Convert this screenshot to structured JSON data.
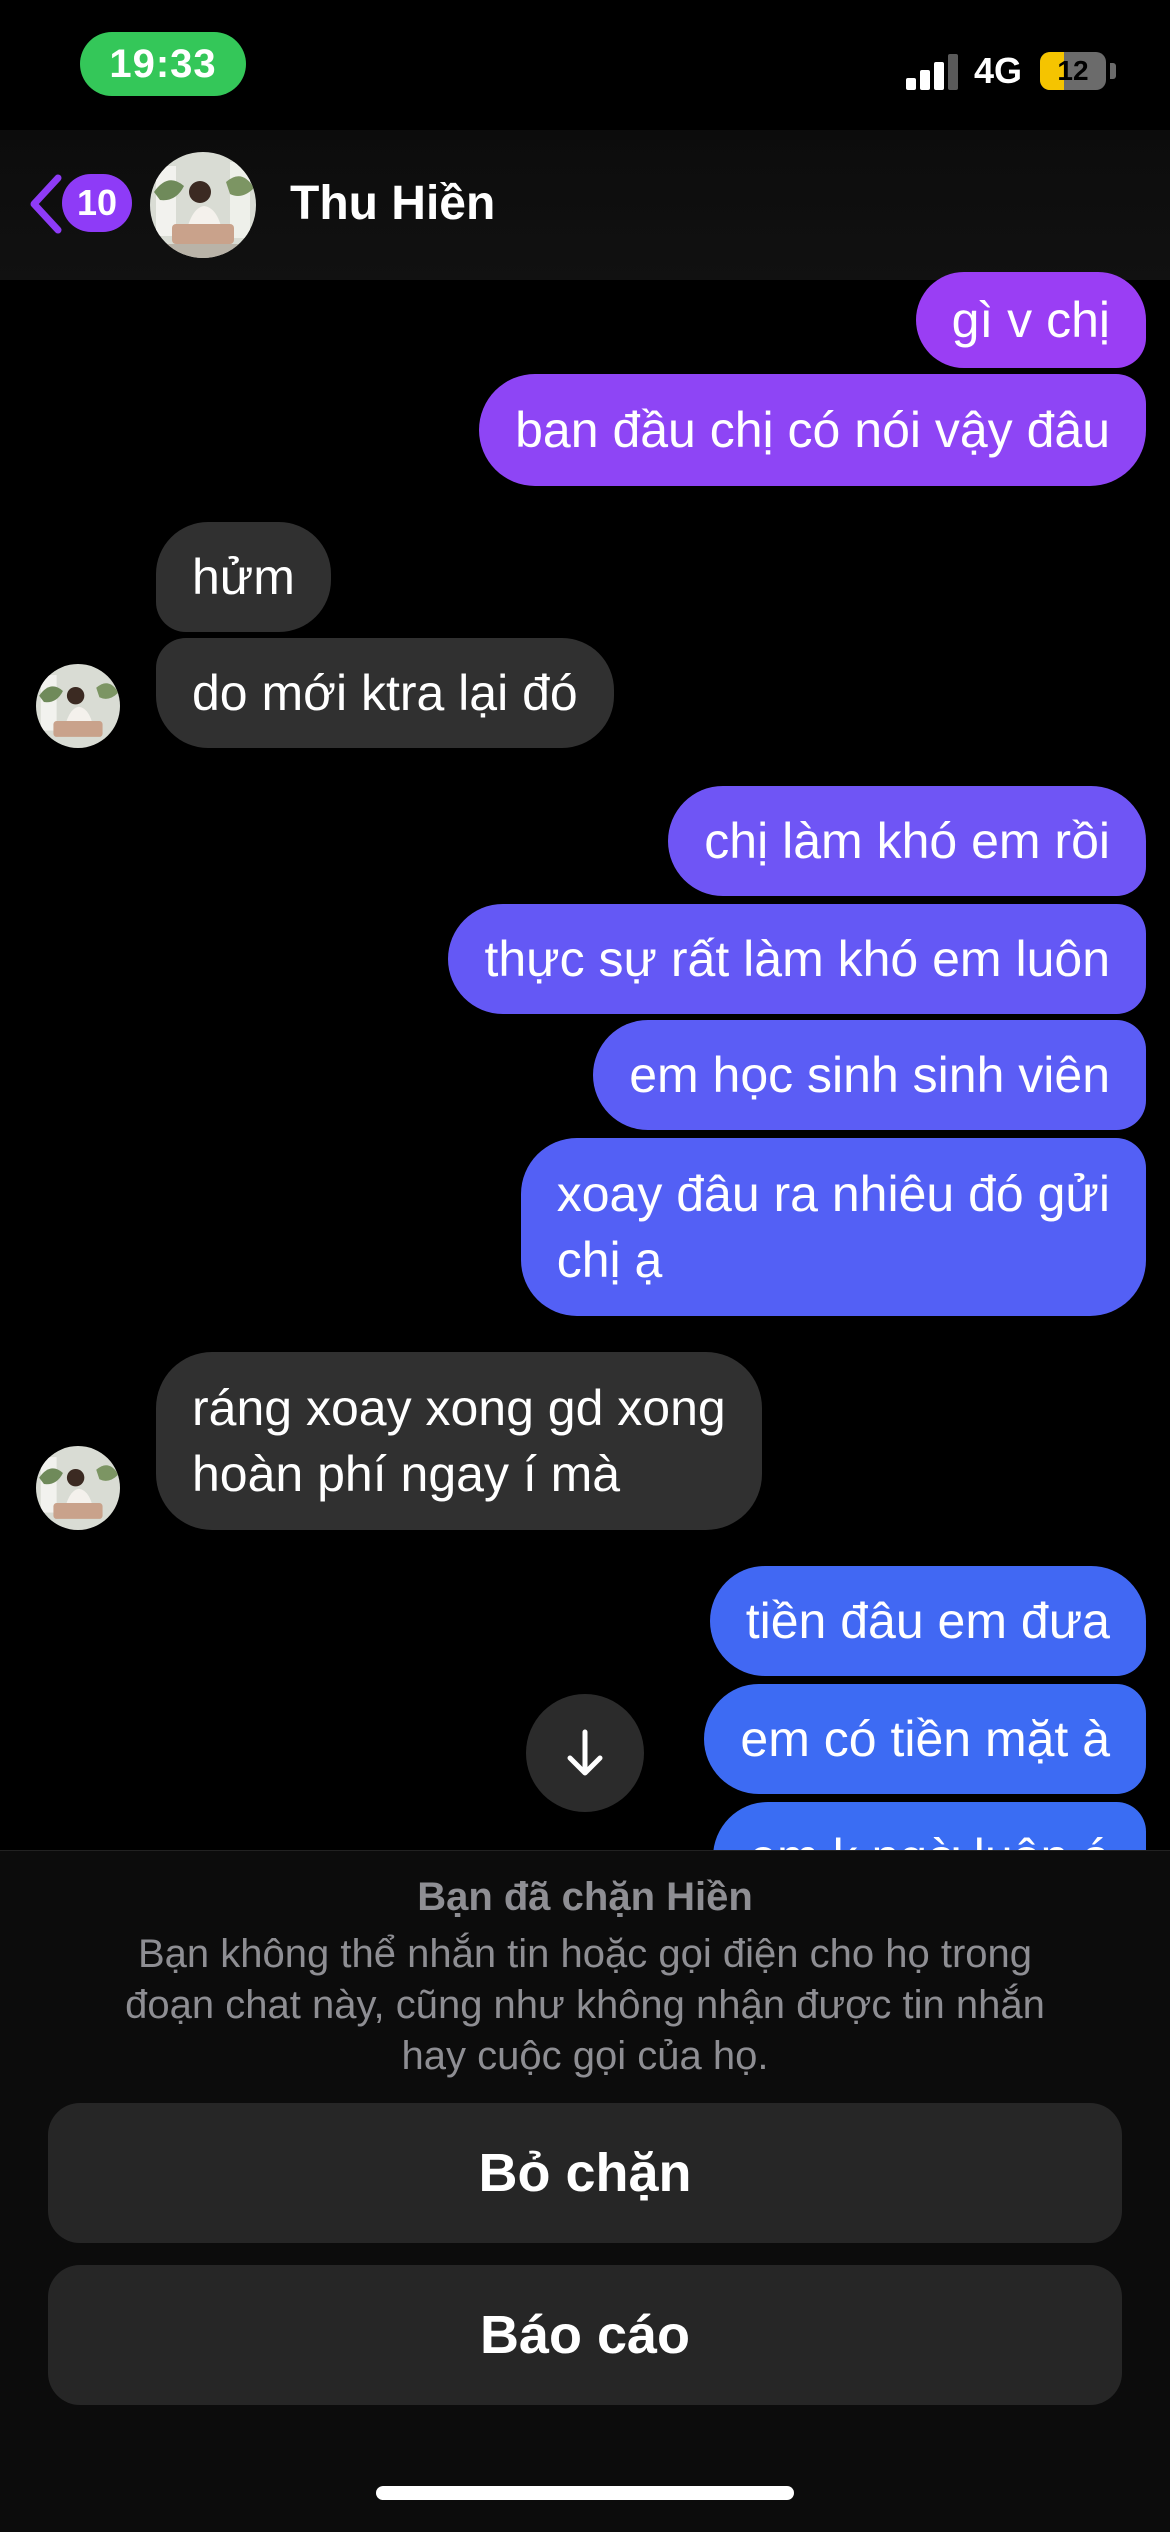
{
  "status_bar": {
    "time": "19:33",
    "network": "4G",
    "battery": "12",
    "battery_level": 0.12
  },
  "header": {
    "unread_count": "10",
    "contact_name": "Thu Hiền"
  },
  "messages": [
    {
      "side": "sent",
      "text": "gì v chị"
    },
    {
      "side": "sent",
      "text": "ban đầu chị có nói vậy đâu"
    },
    {
      "side": "received",
      "text": "hửm"
    },
    {
      "side": "received",
      "text": "do mới ktra lại đó"
    },
    {
      "side": "sent",
      "text": "chị làm khó em rồi"
    },
    {
      "side": "sent",
      "text": "thực sự rất làm khó em luôn"
    },
    {
      "side": "sent",
      "text": "em học sinh sinh viên"
    },
    {
      "side": "sent",
      "line1": "xoay đâu ra nhiêu đó gửi",
      "line2": "chị ạ"
    },
    {
      "side": "received",
      "line1": "ráng xoay xong gd xong",
      "line2": "hoàn phí ngay í mà"
    },
    {
      "side": "sent",
      "text": "tiền đâu em đưa"
    },
    {
      "side": "sent",
      "text": "em có tiền mặt à"
    },
    {
      "side": "sent",
      "text": "em k ngờ luôn á"
    }
  ],
  "block_panel": {
    "title": "Bạn đã chặn Hiền",
    "description_line1": "Bạn không thể nhắn tin hoặc gọi điện cho họ trong",
    "description_line2": "đoạn chat này, cũng như không nhận được tin nhắn",
    "description_line3": "hay cuộc gọi của họ.",
    "unblock_label": "Bỏ chặn",
    "report_label": "Báo cáo"
  },
  "colors": {
    "sent_gradient": [
      "#9b3ef5",
      "#4e63f5",
      "#3d6bf3"
    ],
    "received_bubble": "#303030",
    "badge": "#8e3bf7",
    "time_pill": "#34c759"
  }
}
